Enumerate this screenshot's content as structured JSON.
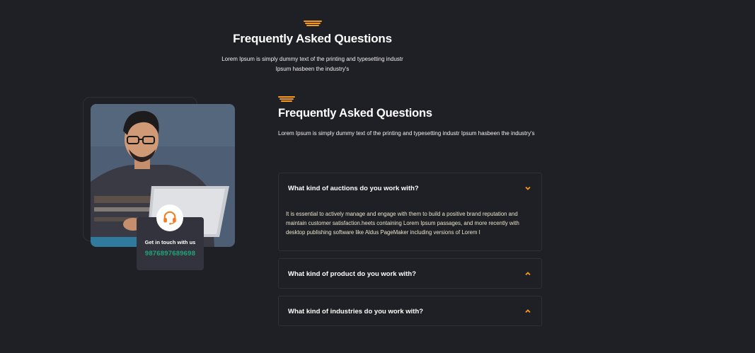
{
  "header": {
    "title": "Frequently Asked Questions",
    "subtitle_line1": "Lorem Ipsum is simply dummy text of the printing and typesetting industr",
    "subtitle_line2": "Ipsum hasbeen the industry's"
  },
  "contact": {
    "icon": "headset-icon",
    "label": "Get in touch with us",
    "phone": "9876897689698"
  },
  "section": {
    "title": "Frequently Asked Questions",
    "subtitle": "Lorem Ipsum is simply dummy text of the printing and typesetting industr Ipsum hasbeen the industry's"
  },
  "faqs": [
    {
      "question": "What kind of auctions do you work with?",
      "answer": "It is essential to actively manage and engage with them to build a positive brand reputation and maintain customer satisfaction.heets containing Lorem Ipsum passages, and more recently with desktop publishing software like Aldus PageMaker including versions of Lorem I",
      "expanded": true
    },
    {
      "question": "What kind of product do you work with?",
      "expanded": false
    },
    {
      "question": "What kind of industries do you work with?",
      "expanded": false
    }
  ],
  "colors": {
    "background": "#1f1f26",
    "accent": "#f59a1b",
    "phone": "#1fa777",
    "card": "#33333d"
  }
}
